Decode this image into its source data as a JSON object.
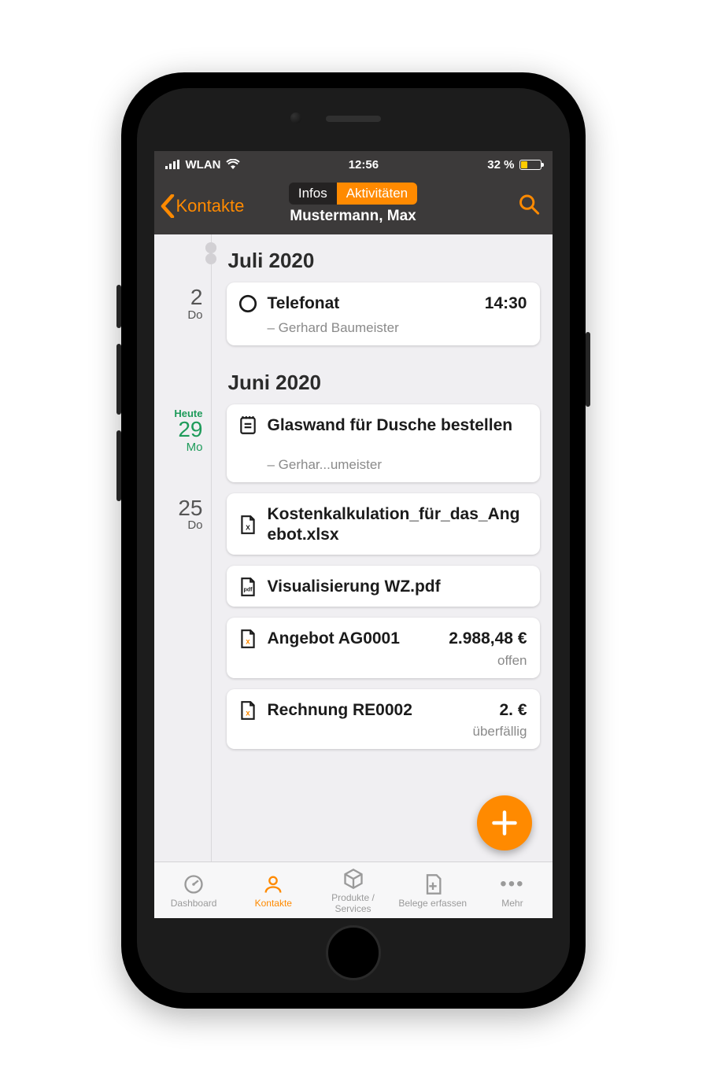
{
  "status_bar": {
    "wlan": "WLAN",
    "time": "12:56",
    "battery_pct": "32 %"
  },
  "nav": {
    "back_label": "Kontakte",
    "seg_infos": "Infos",
    "seg_activities": "Aktivitäten",
    "subtitle": "Mustermann, Max"
  },
  "sections": {
    "july": "Juli 2020",
    "june": "Juni 2020"
  },
  "dates": {
    "d1_num": "2",
    "d1_dw": "Do",
    "d2_heute": "Heute",
    "d2_num": "29",
    "d2_dw": "Mo",
    "d3_num": "25",
    "d3_dw": "Do"
  },
  "items": {
    "call": {
      "title": "Telefonat",
      "time": "14:30",
      "by": "– Gerhard Baumeister"
    },
    "task": {
      "title": "Glaswand für Dusche bestellen",
      "by": "– Gerhar...umeister"
    },
    "xlsx": {
      "title": "Kostenkalkulation_für_das_Angebot.xlsx"
    },
    "pdf": {
      "title": "Visualisierung WZ.pdf"
    },
    "offer": {
      "title": "Angebot AG0001",
      "amount": "2.988,48 €",
      "status": "offen"
    },
    "invoice": {
      "title": "Rechnung RE0002",
      "amount": "2.       €",
      "status": "überfällig"
    }
  },
  "tabs": {
    "dashboard": "Dashboard",
    "kontakte": "Kontakte",
    "produkte": "Produkte / Services",
    "belege": "Belege erfassen",
    "mehr": "Mehr"
  }
}
